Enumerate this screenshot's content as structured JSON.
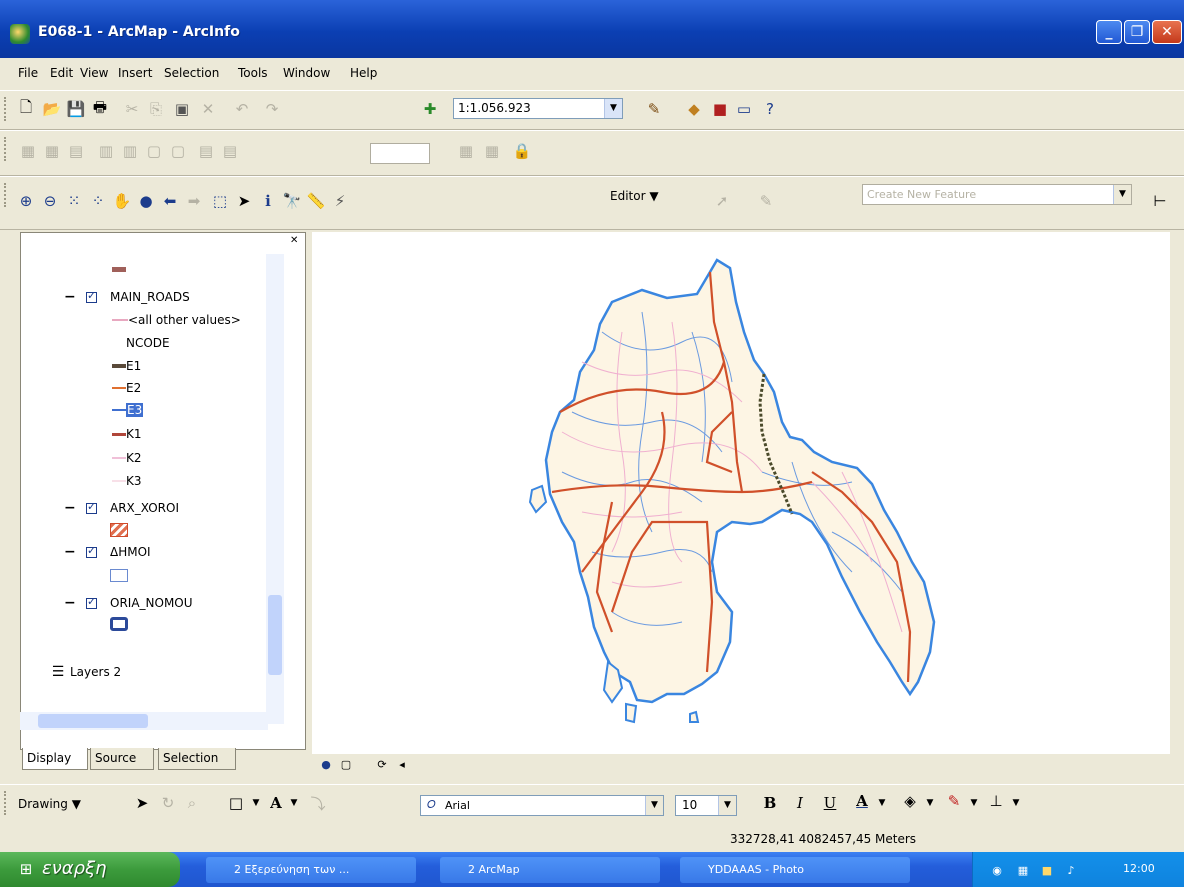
{
  "window": {
    "title": "E068-1 - ArcMap - ArcInfo",
    "minimize": "_",
    "maximize": "❐",
    "close": "✕"
  },
  "menu": [
    "File",
    "Edit",
    "View",
    "Insert",
    "Selection",
    "Tools",
    "Window",
    "Help"
  ],
  "standard_toolbar": {
    "scale": "1:1.056.923"
  },
  "editor_toolbar": {
    "editor_label": "Editor ▼",
    "task_placeholder": "Create New Feature"
  },
  "toc": {
    "layers": [
      {
        "name": "MAIN_ROADS",
        "checked": true,
        "legend": [
          {
            "label": "<all other values>",
            "color": "#e8a8c0"
          },
          {
            "label": "NCODE",
            "color": ""
          },
          {
            "label": "E1",
            "color": "#5a4a3a"
          },
          {
            "label": "E2",
            "color": "#e07030"
          },
          {
            "label": "E3",
            "color": "#3f6fd0"
          },
          {
            "label": "K1",
            "color": "#b0463a"
          },
          {
            "label": "K2",
            "color": "#f0c0d8"
          },
          {
            "label": "K3",
            "color": "#f8e0e8"
          }
        ]
      },
      {
        "name": "ARX_XOROI",
        "checked": true
      },
      {
        "name": "ΔΗΜΟΙ",
        "checked": true
      },
      {
        "name": "ORIA_NOMOU",
        "checked": true
      }
    ],
    "dataframe2": "Layers 2",
    "tabs": [
      "Display",
      "Source",
      "Selection"
    ]
  },
  "drawing_toolbar": {
    "drawing_label": "Drawing ▼",
    "font": "Arial",
    "font_size": "10",
    "bold": "B",
    "italic": "I",
    "underline": "U"
  },
  "status": {
    "coordinates": "332728,41  4082457,45 Meters"
  },
  "taskbar": {
    "start": "εναρξη",
    "buttons": [
      "2 Εξερεύνηση των ...",
      "2 ArcMap",
      "YDDAAAS - Photo"
    ],
    "clock": "12:00"
  },
  "colors": {
    "title_blue": "#0b3fb3",
    "xp_face": "#ece9d8",
    "land": "#fdf5e4",
    "coast": "#3a86e0"
  }
}
